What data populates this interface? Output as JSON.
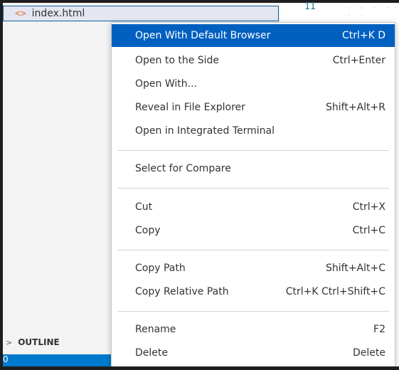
{
  "explorer": {
    "file": {
      "icon": "html-file-icon",
      "glyph": "<>",
      "name": "index.html"
    },
    "outline": {
      "label": "OUTLINE",
      "chevron": ">"
    }
  },
  "editor": {
    "line_number": "11",
    "whitespace": "· · · · · ·"
  },
  "statusbar": {
    "text": "0"
  },
  "context_menu": {
    "items": [
      {
        "label": "Open With Default Browser",
        "shortcut": "Ctrl+K D",
        "active": true
      },
      {
        "label": "Open to the Side",
        "shortcut": "Ctrl+Enter"
      },
      {
        "label": "Open With...",
        "shortcut": ""
      },
      {
        "label": "Reveal in File Explorer",
        "shortcut": "Shift+Alt+R"
      },
      {
        "label": "Open in Integrated Terminal",
        "shortcut": ""
      },
      {
        "label": "Select for Compare",
        "shortcut": ""
      },
      {
        "label": "Cut",
        "shortcut": "Ctrl+X"
      },
      {
        "label": "Copy",
        "shortcut": "Ctrl+C"
      },
      {
        "label": "Copy Path",
        "shortcut": "Shift+Alt+C"
      },
      {
        "label": "Copy Relative Path",
        "shortcut": "Ctrl+K Ctrl+Shift+C"
      },
      {
        "label": "Rename",
        "shortcut": "F2"
      },
      {
        "label": "Delete",
        "shortcut": "Delete"
      }
    ]
  },
  "colors": {
    "accent": "#0060c0",
    "statusbar": "#007acc",
    "html_icon": "#e37933"
  }
}
